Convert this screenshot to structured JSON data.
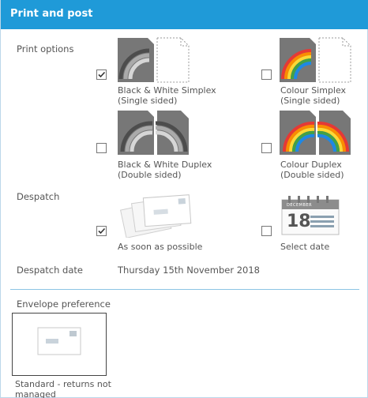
{
  "panel": {
    "title": "Print and post"
  },
  "print_options": {
    "label": "Print options",
    "options": [
      {
        "line1": "Black & White Simplex",
        "line2": "(Single sided)",
        "checked": true
      },
      {
        "line1": "Colour Simplex",
        "line2": "(Single sided)",
        "checked": false
      },
      {
        "line1": "Black & White Duplex",
        "line2": "(Double sided)",
        "checked": false
      },
      {
        "line1": "Colour Duplex",
        "line2": "(Double sided)",
        "checked": false
      }
    ]
  },
  "despatch": {
    "label": "Despatch",
    "options": [
      {
        "label": "As soon as possible",
        "checked": true
      },
      {
        "label": "Select date",
        "checked": false
      }
    ],
    "calendar": {
      "month": "DECEMBER",
      "day": "18"
    }
  },
  "despatch_date": {
    "label": "Despatch date",
    "value": "Thursday 15th November 2018"
  },
  "envelope": {
    "label": "Envelope preference",
    "option_line1": "Standard - returns not",
    "option_line2": "managed"
  },
  "colors": {
    "header": "#1f9ad8",
    "separator": "#8cc4e4",
    "text": "#555555"
  }
}
